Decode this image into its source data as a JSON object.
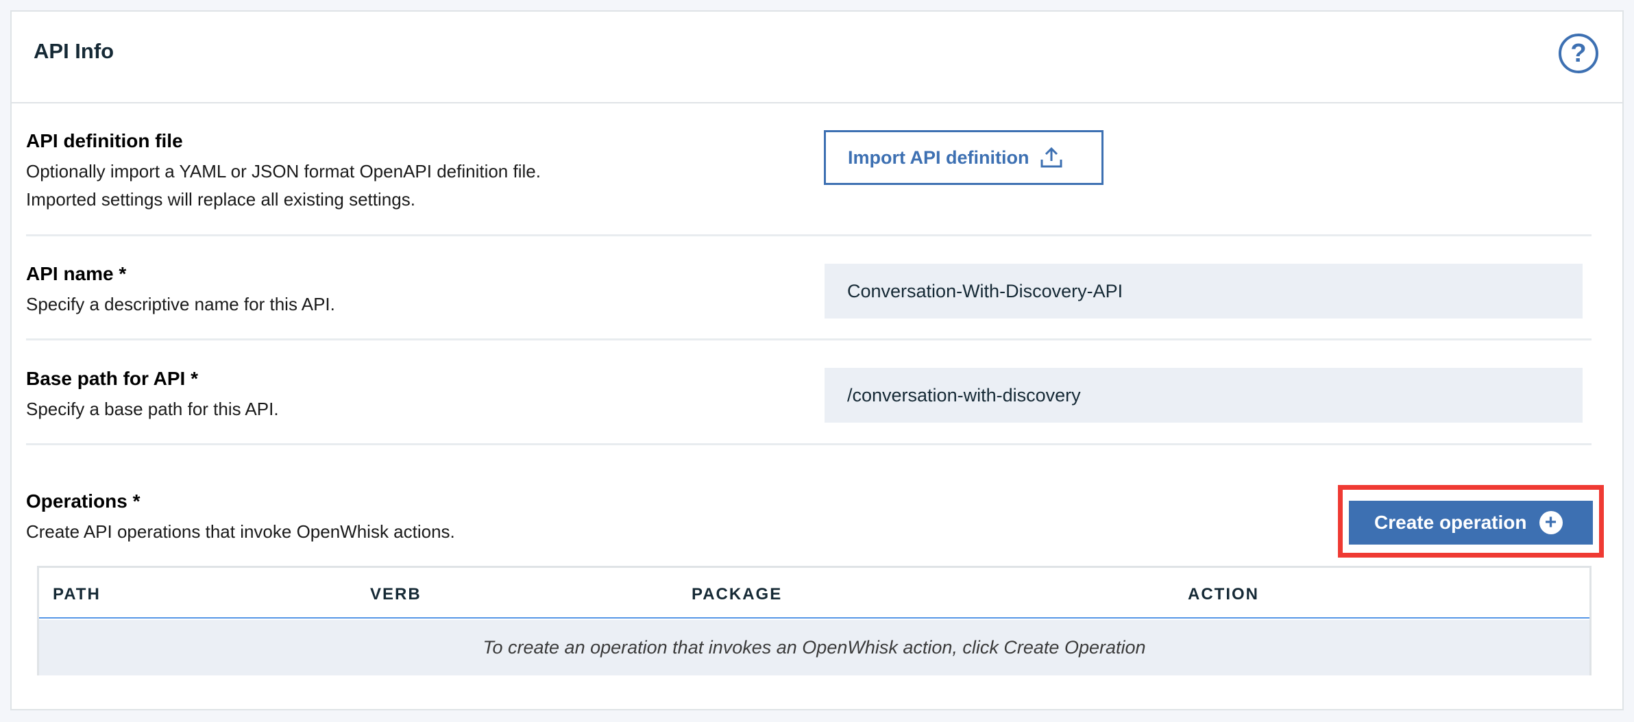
{
  "panel": {
    "title": "API Info",
    "help_icon": "help-circle-icon",
    "help_glyph": "?"
  },
  "definition_file": {
    "label": "API definition file",
    "desc_line1": "Optionally import a YAML or JSON format OpenAPI definition file.",
    "desc_line2": "Imported settings will replace all existing settings.",
    "import_button_label": "Import API definition",
    "import_icon": "upload-icon"
  },
  "api_name": {
    "label": "API name *",
    "desc": "Specify a descriptive name for this API.",
    "value": "Conversation-With-Discovery-API"
  },
  "base_path": {
    "label": "Base path for API *",
    "desc": "Specify a base path for this API.",
    "value": "/conversation-with-discovery"
  },
  "operations": {
    "label": "Operations *",
    "desc": "Create API operations that invoke OpenWhisk actions.",
    "create_button_label": "Create operation",
    "create_icon": "plus-circle-icon",
    "columns": [
      "PATH",
      "VERB",
      "PACKAGE",
      "ACTION"
    ],
    "empty_message": "To create an operation that invokes an OpenWhisk action, click Create Operation"
  },
  "colors": {
    "accent": "#3d70b2",
    "highlight": "#ef3a33",
    "field_bg": "#ebeff5"
  }
}
